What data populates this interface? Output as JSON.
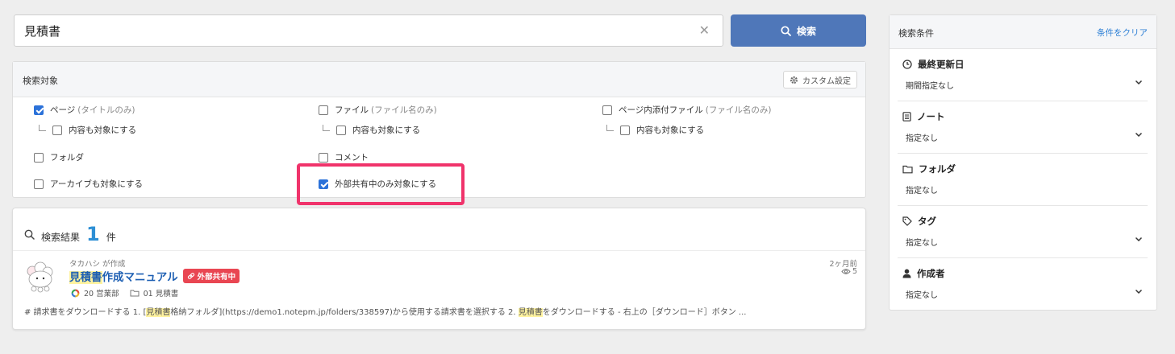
{
  "search": {
    "value": "見積書",
    "clear_icon": "close-icon",
    "button_label": "検索",
    "accent": "#4f77b9"
  },
  "target": {
    "title": "検索対象",
    "custom_label": "カスタム設定",
    "page": {
      "label": "ページ",
      "note": "(タイトルのみ)",
      "checked": true
    },
    "page_content": {
      "label": "内容も対象にする",
      "checked": false
    },
    "file": {
      "label": "ファイル",
      "note": "(ファイル名のみ)",
      "checked": false
    },
    "file_content": {
      "label": "内容も対象にする",
      "checked": false
    },
    "attach": {
      "label": "ページ内添付ファイル",
      "note": "(ファイル名のみ)",
      "checked": false
    },
    "attach_content": {
      "label": "内容も対象にする",
      "checked": false
    },
    "folder": {
      "label": "フォルダ",
      "checked": false
    },
    "comment": {
      "label": "コメント",
      "checked": false
    },
    "archive": {
      "label": "アーカイブも対象にする",
      "checked": false
    },
    "shared": {
      "label": "外部共有中のみ対象にする",
      "checked": true
    }
  },
  "results": {
    "label": "検索結果",
    "count": "1",
    "unit": "件",
    "items": [
      {
        "creator": "タカハシ が作成",
        "title_highlight": "見積書",
        "title_rest": "作成マニュアル",
        "badge": "外部共有中",
        "team": "20 営業部",
        "folder": "01 見積書",
        "time": "2ヶ月前",
        "views": "5",
        "snippet_1": "# 請求書をダウンロードする 1. [",
        "snippet_hl_1": "見積書",
        "snippet_2": "格納フォルダ](https://demo1.notepm.jp/folders/338597)から使用する請求書を選択する 2. ",
        "snippet_hl_2": "見積書",
        "snippet_3": "をダウンロードする - 右上の［ダウンロード］ボタン ..."
      }
    ]
  },
  "filters": {
    "title": "検索条件",
    "clear_label": "条件をクリア",
    "sections": [
      {
        "label": "最終更新日",
        "icon": "clock-icon",
        "value": "期間指定なし"
      },
      {
        "label": "ノート",
        "icon": "notebook-icon",
        "value": "指定なし"
      },
      {
        "label": "フォルダ",
        "icon": "folder-icon",
        "value": "指定なし"
      },
      {
        "label": "タグ",
        "icon": "tag-icon",
        "value": "指定なし"
      },
      {
        "label": "作成者",
        "icon": "person-icon",
        "value": "指定なし"
      }
    ]
  },
  "colors": {
    "highlight_box": "#f0336b",
    "badge": "#e94652",
    "link": "#1d5fb3",
    "count": "#2d8fd5"
  }
}
